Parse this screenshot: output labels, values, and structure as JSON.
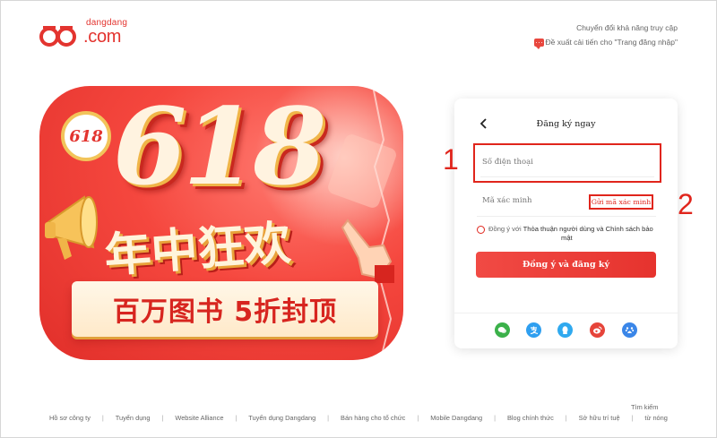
{
  "header": {
    "logo_small": "dangdang",
    "logo_big": ".com",
    "accessibility_link": "Chuyển đổi khả năng truy cập",
    "feedback_link": "Đề xuất cải tiến cho \"Trang đăng nhập\""
  },
  "banner": {
    "badge": "618",
    "headline": "618",
    "subheadline": "年中狂欢",
    "ribbon": "百万图书 5折封顶"
  },
  "login": {
    "title": "Đăng ký ngay",
    "phone_placeholder": "Số điện thoại",
    "code_placeholder": "Mã xác minh",
    "send_code": "Gửi mã xác minh",
    "agree_prefix": "Đồng ý với ",
    "agree_terms": "Thỏa thuận người dùng và Chính sách bảo",
    "agree_terms_cont": "mật",
    "submit": "Đồng ý và đăng ký",
    "annotation_1": "1",
    "annotation_2": "2"
  },
  "social": [
    {
      "icon": "wechat-icon",
      "color": "#3bb14a"
    },
    {
      "icon": "alipay-icon",
      "color": "#2f9ff0"
    },
    {
      "icon": "qq-icon",
      "color": "#2fa9ef"
    },
    {
      "icon": "weibo-icon",
      "color": "#e6443a"
    },
    {
      "icon": "baidu-icon",
      "color": "#3a86e8"
    }
  ],
  "footer": {
    "links": [
      "Hồ sơ công ty",
      "Tuyển dụng",
      "Website Alliance",
      "Tuyển dụng Dangdang",
      "Bán hàng cho tổ chức",
      "Mobile Dangdang",
      "Blog chính thức",
      "Sở hữu trí tuệ",
      "từ nóng"
    ],
    "search_hint": "Tìm kiếm"
  },
  "colors": {
    "brand_red": "#e0251c"
  }
}
